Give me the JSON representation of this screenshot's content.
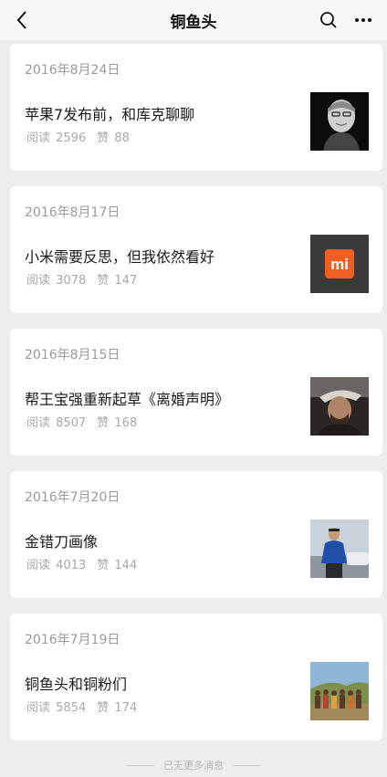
{
  "header": {
    "title": "铜鱼头"
  },
  "articles": [
    {
      "date": "2016年8月24日",
      "title": "苹果7发布前，和库克聊聊",
      "read_label": "阅读",
      "reads": "2596",
      "like_label": "赞",
      "likes": "88",
      "thumb": "tim-cook-portrait"
    },
    {
      "date": "2016年8月17日",
      "title": "小米需要反思，但我依然看好",
      "read_label": "阅读",
      "reads": "3078",
      "like_label": "赞",
      "likes": "147",
      "thumb": "xiaomi-logo",
      "thumb_text": "mi"
    },
    {
      "date": "2016年8月15日",
      "title": "帮王宝强重新起草《离婚声明》",
      "read_label": "阅读",
      "reads": "8507",
      "like_label": "赞",
      "likes": "168",
      "thumb": "man-with-hat-portrait"
    },
    {
      "date": "2016年7月20日",
      "title": "金错刀画像",
      "read_label": "阅读",
      "reads": "4013",
      "like_label": "赞",
      "likes": "144",
      "thumb": "man-in-blue-shirt-photo"
    },
    {
      "date": "2016年7月19日",
      "title": "铜鱼头和铜粉们",
      "read_label": "阅读",
      "reads": "5854",
      "like_label": "赞",
      "likes": "174",
      "thumb": "group-photo-outdoors"
    }
  ],
  "footer": {
    "text": "已无更多消息"
  },
  "colors": {
    "background": "#ededed",
    "card": "#ffffff",
    "xiaomi_orange": "#f25f22"
  }
}
